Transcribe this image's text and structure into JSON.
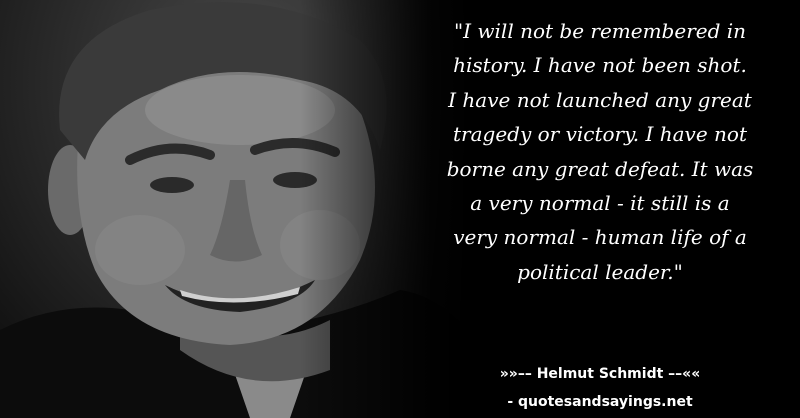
{
  "quote": {
    "text": "\"I will not be remembered in history. I have not been shot. I have not launched any great tragedy or victory. I have not borne any great defeat. It was a very normal - it still is a very normal - human life of a political leader.\"",
    "lines": [
      "\"I will not be remembered in",
      "history. I have not been shot.",
      "I have not launched any great",
      "tragedy or victory. I have not",
      "borne any great defeat. It was",
      "a very normal - it still is a",
      "very normal - human life of a",
      "political leader.\""
    ]
  },
  "author": {
    "line": "»»–– Helmut Schmidt ––««"
  },
  "source": {
    "line": "- quotesandsayings.net"
  },
  "colors": {
    "background": "#000000",
    "text": "#ffffff"
  }
}
